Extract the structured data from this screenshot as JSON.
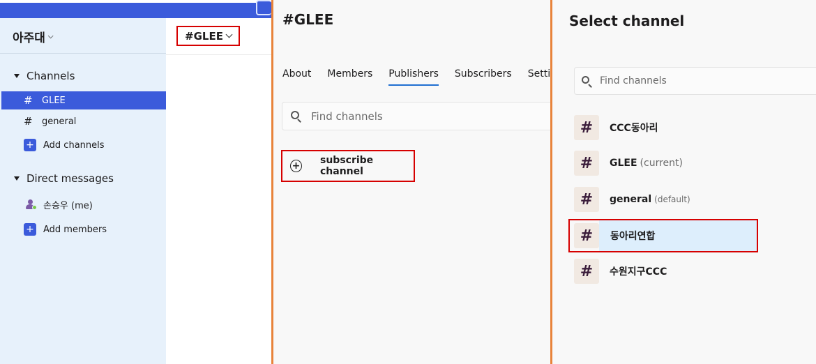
{
  "panel1": {
    "workspace_name": "아주대",
    "channels_section": "Channels",
    "channels": [
      {
        "label": "GLEE",
        "active": true
      },
      {
        "label": "general",
        "active": false
      }
    ],
    "add_channels": "Add channels",
    "dm_section": "Direct messages",
    "dm_user": "손승우 (me)",
    "add_members": "Add members",
    "channel_title": "#GLEE"
  },
  "panel2": {
    "title": "#GLEE",
    "tabs": [
      {
        "label": "About",
        "active": false
      },
      {
        "label": "Members",
        "active": false
      },
      {
        "label": "Publishers",
        "active": true
      },
      {
        "label": "Subscribers",
        "active": false
      },
      {
        "label": "Settings",
        "active": false
      }
    ],
    "search_placeholder": "Find channels",
    "subscribe_label": "subscribe channel"
  },
  "panel3": {
    "title": "Select channel",
    "search_placeholder": "Find channels",
    "channels": [
      {
        "hash": "#",
        "name": "CCC동아리",
        "suffix": ""
      },
      {
        "hash": "#",
        "name": "GLEE",
        "suffix": "(current)"
      },
      {
        "hash": "#",
        "name": "general",
        "suffix": "(default)"
      },
      {
        "hash": "#",
        "name": "동아리연합",
        "suffix": ""
      },
      {
        "hash": "#",
        "name": "수원지구CCC",
        "suffix": ""
      }
    ]
  },
  "colors": {
    "accent": "#3b5bdb",
    "sidebar_bg": "#e7f1fb",
    "divider_orange": "#e8833a",
    "highlight_red": "#d60000",
    "tab_underline": "#1f6fd1"
  }
}
